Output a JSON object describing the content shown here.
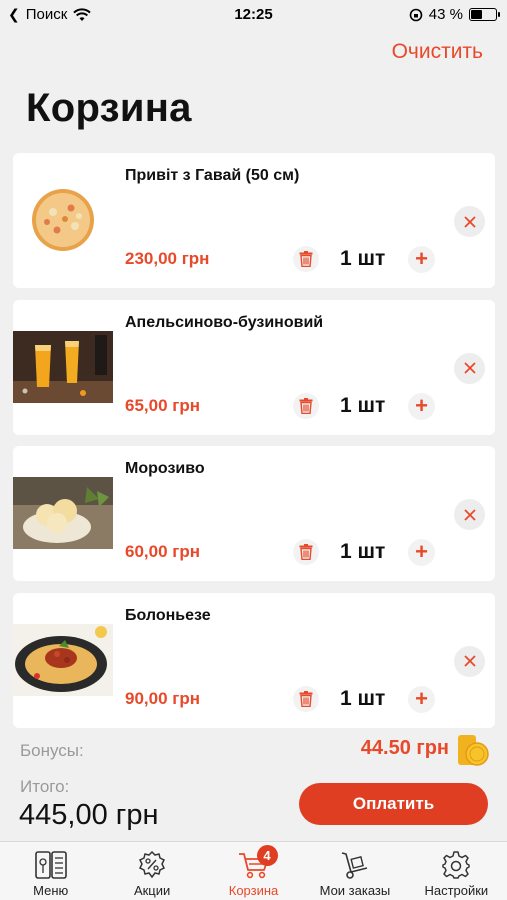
{
  "status_bar": {
    "back_label": "Поиск",
    "time": "12:25",
    "battery": "43 %",
    "battery_level": 0.43
  },
  "header": {
    "clear_label": "Очистить",
    "title": "Корзина"
  },
  "cart": {
    "items": [
      {
        "name": "Привіт з Гавай (50 см)",
        "price": "230,00 грн",
        "qty": "1 шт",
        "image": "pizza-image"
      },
      {
        "name": "Апельсиново-бузиновий",
        "price": "65,00 грн",
        "qty": "1 шт",
        "image": "orange-drink-image"
      },
      {
        "name": "Морозиво",
        "price": "60,00 грн",
        "qty": "1 шт",
        "image": "ice-cream-image"
      },
      {
        "name": "Болоньезе",
        "price": "90,00 грн",
        "qty": "1 шт",
        "image": "spaghetti-image"
      }
    ]
  },
  "summary": {
    "bonus_label": "Бонусы:",
    "bonus_value": "44.50 грн",
    "total_label": "Итого:",
    "total_value": "445,00 грн",
    "pay_label": "Оплатить"
  },
  "tabs": [
    {
      "label": "Меню",
      "icon": "menu-book-icon"
    },
    {
      "label": "Акции",
      "icon": "discount-icon"
    },
    {
      "label": "Корзина",
      "icon": "cart-icon",
      "badge": "4",
      "active": true
    },
    {
      "label": "Мои заказы",
      "icon": "hand-truck-icon"
    },
    {
      "label": "Настройки",
      "icon": "gear-icon"
    }
  ],
  "colors": {
    "accent": "#e8492a",
    "button": "#e03e22",
    "background": "#f0f0f0"
  }
}
